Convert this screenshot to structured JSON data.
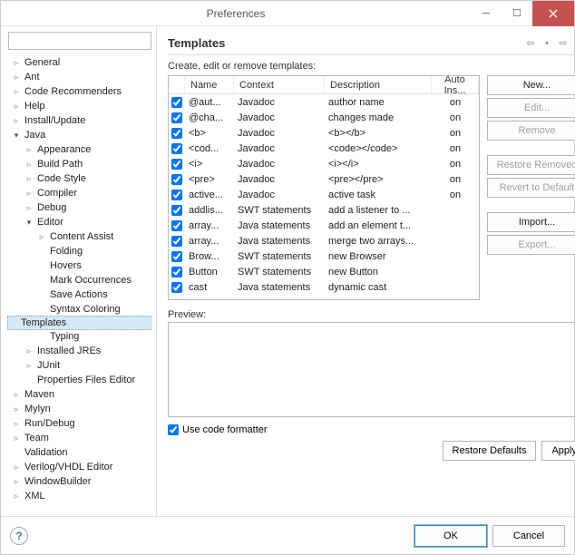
{
  "window": {
    "title": "Preferences"
  },
  "tree": [
    {
      "label": "General",
      "level": 0,
      "arrow": "collapsed"
    },
    {
      "label": "Ant",
      "level": 0,
      "arrow": "collapsed"
    },
    {
      "label": "Code Recommenders",
      "level": 0,
      "arrow": "collapsed"
    },
    {
      "label": "Help",
      "level": 0,
      "arrow": "collapsed"
    },
    {
      "label": "Install/Update",
      "level": 0,
      "arrow": "collapsed"
    },
    {
      "label": "Java",
      "level": 0,
      "arrow": "expanded"
    },
    {
      "label": "Appearance",
      "level": 1,
      "arrow": "collapsed"
    },
    {
      "label": "Build Path",
      "level": 1,
      "arrow": "collapsed"
    },
    {
      "label": "Code Style",
      "level": 1,
      "arrow": "collapsed"
    },
    {
      "label": "Compiler",
      "level": 1,
      "arrow": "collapsed"
    },
    {
      "label": "Debug",
      "level": 1,
      "arrow": "collapsed"
    },
    {
      "label": "Editor",
      "level": 1,
      "arrow": "expanded"
    },
    {
      "label": "Content Assist",
      "level": 2,
      "arrow": "collapsed"
    },
    {
      "label": "Folding",
      "level": 2,
      "arrow": "none"
    },
    {
      "label": "Hovers",
      "level": 2,
      "arrow": "none"
    },
    {
      "label": "Mark Occurrences",
      "level": 2,
      "arrow": "none"
    },
    {
      "label": "Save Actions",
      "level": 2,
      "arrow": "none"
    },
    {
      "label": "Syntax Coloring",
      "level": 2,
      "arrow": "none"
    },
    {
      "label": "Templates",
      "level": 2,
      "arrow": "none",
      "selected": true
    },
    {
      "label": "Typing",
      "level": 2,
      "arrow": "none"
    },
    {
      "label": "Installed JREs",
      "level": 1,
      "arrow": "collapsed"
    },
    {
      "label": "JUnit",
      "level": 1,
      "arrow": "collapsed"
    },
    {
      "label": "Properties Files Editor",
      "level": 1,
      "arrow": "none"
    },
    {
      "label": "Maven",
      "level": 0,
      "arrow": "collapsed"
    },
    {
      "label": "Mylyn",
      "level": 0,
      "arrow": "collapsed"
    },
    {
      "label": "Run/Debug",
      "level": 0,
      "arrow": "collapsed"
    },
    {
      "label": "Team",
      "level": 0,
      "arrow": "collapsed"
    },
    {
      "label": "Validation",
      "level": 0,
      "arrow": "none"
    },
    {
      "label": "Verilog/VHDL Editor",
      "level": 0,
      "arrow": "collapsed"
    },
    {
      "label": "WindowBuilder",
      "level": 0,
      "arrow": "collapsed"
    },
    {
      "label": "XML",
      "level": 0,
      "arrow": "collapsed"
    }
  ],
  "page": {
    "title": "Templates",
    "subhead": "Create, edit or remove templates:",
    "columns": {
      "name": "Name",
      "context": "Context",
      "description": "Description",
      "autoinsert": "Auto Ins..."
    },
    "rows": [
      {
        "name": "@aut...",
        "context": "Javadoc",
        "description": "author name",
        "auto": "on"
      },
      {
        "name": "@cha...",
        "context": "Javadoc",
        "description": "changes made",
        "auto": "on"
      },
      {
        "name": "<b>",
        "context": "Javadoc",
        "description": "<b></b>",
        "auto": "on"
      },
      {
        "name": "<cod...",
        "context": "Javadoc",
        "description": "<code></code>",
        "auto": "on"
      },
      {
        "name": "<i>",
        "context": "Javadoc",
        "description": "<i></i>",
        "auto": "on"
      },
      {
        "name": "<pre>",
        "context": "Javadoc",
        "description": "<pre></pre>",
        "auto": "on"
      },
      {
        "name": "active...",
        "context": "Javadoc",
        "description": "active task",
        "auto": "on"
      },
      {
        "name": "addlis...",
        "context": "SWT statements",
        "description": "add a listener to ...",
        "auto": ""
      },
      {
        "name": "array...",
        "context": "Java statements",
        "description": "add an element t...",
        "auto": ""
      },
      {
        "name": "array...",
        "context": "Java statements",
        "description": "merge two arrays...",
        "auto": ""
      },
      {
        "name": "Brow...",
        "context": "SWT statements",
        "description": "new Browser",
        "auto": ""
      },
      {
        "name": "Button",
        "context": "SWT statements",
        "description": "new Button",
        "auto": ""
      },
      {
        "name": "cast",
        "context": "Java statements",
        "description": "dynamic cast",
        "auto": ""
      }
    ],
    "buttons": {
      "new": "New...",
      "edit": "Edit...",
      "remove": "Remove",
      "restore_removed": "Restore Removed",
      "revert": "Revert to Default",
      "import": "Import...",
      "export": "Export..."
    },
    "preview_label": "Preview:",
    "use_formatter": "Use code formatter",
    "restore_defaults": "Restore Defaults",
    "apply": "Apply"
  },
  "footer": {
    "ok": "OK",
    "cancel": "Cancel"
  }
}
